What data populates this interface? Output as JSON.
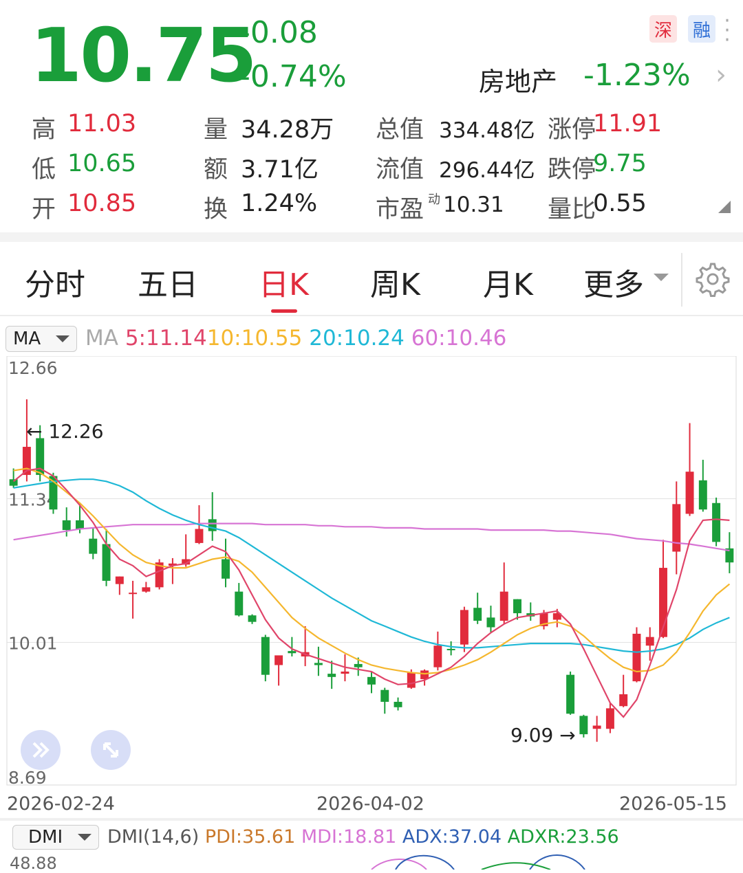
{
  "quote": {
    "price": "10.75",
    "change": "-0.08",
    "change_pct": "-0.74%",
    "sector_name": "房地产",
    "sector_change": "-1.23%",
    "exchange_tag": "深",
    "margin_tag": "融"
  },
  "stats": [
    [
      {
        "label": "高",
        "value": "11.03",
        "tone": "red"
      },
      {
        "label": "量",
        "value": "34.28万",
        "tone": "dark"
      },
      {
        "label": "总值",
        "value": "334.48亿",
        "tone": "dark"
      },
      {
        "label": "涨停",
        "value": "11.91",
        "tone": "red"
      }
    ],
    [
      {
        "label": "低",
        "value": "10.65",
        "tone": "green"
      },
      {
        "label": "额",
        "value": "3.71亿",
        "tone": "dark"
      },
      {
        "label": "流值",
        "value": "296.44亿",
        "tone": "dark"
      },
      {
        "label": "跌停",
        "value": "9.75",
        "tone": "green"
      }
    ],
    [
      {
        "label": "开",
        "value": "10.85",
        "tone": "red"
      },
      {
        "label": "换",
        "value": "1.24%",
        "tone": "dark"
      },
      {
        "label": "市盈",
        "sup": "动",
        "value": "10.31",
        "tone": "dark"
      },
      {
        "label": "量比",
        "value": "0.55",
        "tone": "dark"
      }
    ]
  ],
  "tabs": [
    {
      "label": "分时"
    },
    {
      "label": "五日"
    },
    {
      "label": "日K",
      "active": true
    },
    {
      "label": "周K"
    },
    {
      "label": "月K"
    },
    {
      "label": "更多"
    }
  ],
  "ma_bar": {
    "selector": "MA",
    "prefix": "MA",
    "ma5": "5:11.14",
    "ma10": "10:10.55",
    "ma20": "20:10.24",
    "ma60": "60:10.46"
  },
  "dmi_bar": {
    "selector": "DMI",
    "name": "DMI(14,6)",
    "pdi": "PDI:35.61",
    "mdi": "MDI:18.81",
    "adx": "ADX:37.04",
    "adxr": "ADXR:23.56",
    "ymax": "48.88"
  },
  "colors": {
    "up": "#e12b3c",
    "down": "#1a9e3a",
    "ma5": "#e0456a",
    "ma10": "#f5b72e",
    "ma20": "#1fb8d6",
    "ma60": "#d774d4",
    "pdi": "#c9782a",
    "mdi": "#d774d4",
    "adx": "#2f5fb3",
    "adxr": "#1a9e3a"
  },
  "chart_data": {
    "type": "candlestick",
    "y_ticks": [
      "12.66",
      "11.34",
      "10.01",
      "8.69"
    ],
    "ylim": [
      8.69,
      12.66
    ],
    "x_labels": [
      "2026-02-24",
      "2026-04-02",
      "2026-05-15"
    ],
    "annotations": [
      {
        "text": "← 12.26",
        "price": 12.26
      },
      {
        "text": "9.09 →",
        "price": 9.09
      }
    ],
    "candles": [
      {
        "o": 11.52,
        "h": 11.62,
        "l": 11.44,
        "c": 11.46
      },
      {
        "o": 11.56,
        "h": 12.26,
        "l": 11.5,
        "c": 11.82
      },
      {
        "o": 11.9,
        "h": 12.02,
        "l": 11.5,
        "c": 11.56
      },
      {
        "o": 11.55,
        "h": 11.58,
        "l": 11.2,
        "c": 11.24
      },
      {
        "o": 11.14,
        "h": 11.26,
        "l": 10.99,
        "c": 11.05
      },
      {
        "o": 11.14,
        "h": 11.29,
        "l": 11.02,
        "c": 11.06
      },
      {
        "o": 10.97,
        "h": 11.07,
        "l": 10.78,
        "c": 10.83
      },
      {
        "o": 10.92,
        "h": 11.06,
        "l": 10.53,
        "c": 10.58
      },
      {
        "o": 10.55,
        "h": 10.62,
        "l": 10.45,
        "c": 10.62
      },
      {
        "o": 10.47,
        "h": 10.58,
        "l": 10.23,
        "c": 10.47
      },
      {
        "o": 10.48,
        "h": 10.57,
        "l": 10.47,
        "c": 10.52
      },
      {
        "o": 10.52,
        "h": 10.78,
        "l": 10.5,
        "c": 10.75
      },
      {
        "o": 10.72,
        "h": 10.79,
        "l": 10.55,
        "c": 10.74
      },
      {
        "o": 10.73,
        "h": 11.01,
        "l": 10.71,
        "c": 10.78
      },
      {
        "o": 10.93,
        "h": 11.28,
        "l": 10.92,
        "c": 11.06
      },
      {
        "o": 11.15,
        "h": 11.4,
        "l": 10.95,
        "c": 11.04
      },
      {
        "o": 10.78,
        "h": 10.97,
        "l": 10.52,
        "c": 10.6
      },
      {
        "o": 10.48,
        "h": 10.56,
        "l": 10.25,
        "c": 10.26
      },
      {
        "o": 10.26,
        "h": 10.27,
        "l": 10.18,
        "c": 10.2
      },
      {
        "o": 10.06,
        "h": 10.08,
        "l": 9.65,
        "c": 9.71
      },
      {
        "o": 9.8,
        "h": 9.86,
        "l": 9.61,
        "c": 9.89
      },
      {
        "o": 9.93,
        "h": 10.06,
        "l": 9.88,
        "c": 9.91
      },
      {
        "o": 9.88,
        "h": 10.16,
        "l": 9.79,
        "c": 9.92
      },
      {
        "o": 9.82,
        "h": 9.97,
        "l": 9.7,
        "c": 9.8
      },
      {
        "o": 9.72,
        "h": 9.84,
        "l": 9.58,
        "c": 9.69
      },
      {
        "o": 9.72,
        "h": 9.9,
        "l": 9.65,
        "c": 9.74
      },
      {
        "o": 9.81,
        "h": 9.87,
        "l": 9.7,
        "c": 9.78
      },
      {
        "o": 9.69,
        "h": 9.74,
        "l": 9.54,
        "c": 9.62
      },
      {
        "o": 9.57,
        "h": 9.59,
        "l": 9.35,
        "c": 9.46
      },
      {
        "o": 9.46,
        "h": 9.5,
        "l": 9.38,
        "c": 9.41
      },
      {
        "o": 9.59,
        "h": 9.76,
        "l": 9.58,
        "c": 9.73
      },
      {
        "o": 9.67,
        "h": 9.76,
        "l": 9.61,
        "c": 9.75
      },
      {
        "o": 9.78,
        "h": 10.11,
        "l": 9.75,
        "c": 9.98
      },
      {
        "o": 9.95,
        "h": 10.02,
        "l": 9.89,
        "c": 9.94
      },
      {
        "o": 9.99,
        "h": 10.34,
        "l": 9.92,
        "c": 10.31
      },
      {
        "o": 10.33,
        "h": 10.47,
        "l": 10.18,
        "c": 10.21
      },
      {
        "o": 10.24,
        "h": 10.35,
        "l": 10.1,
        "c": 10.15
      },
      {
        "o": 10.21,
        "h": 10.75,
        "l": 10.18,
        "c": 10.48
      },
      {
        "o": 10.41,
        "h": 10.41,
        "l": 10.22,
        "c": 10.28
      },
      {
        "o": 10.28,
        "h": 10.38,
        "l": 10.21,
        "c": 10.25
      },
      {
        "o": 10.16,
        "h": 10.31,
        "l": 10.13,
        "c": 10.28
      },
      {
        "o": 10.22,
        "h": 10.32,
        "l": 10.15,
        "c": 10.28
      },
      {
        "o": 9.71,
        "h": 9.74,
        "l": 9.34,
        "c": 9.35
      },
      {
        "o": 9.33,
        "h": 9.34,
        "l": 9.13,
        "c": 9.16
      },
      {
        "o": 9.21,
        "h": 9.33,
        "l": 9.09,
        "c": 9.24
      },
      {
        "o": 9.21,
        "h": 9.45,
        "l": 9.17,
        "c": 9.4
      },
      {
        "o": 9.42,
        "h": 9.71,
        "l": 9.41,
        "c": 9.53
      },
      {
        "o": 9.65,
        "h": 10.15,
        "l": 9.64,
        "c": 10.09
      },
      {
        "o": 9.98,
        "h": 10.15,
        "l": 9.84,
        "c": 10.06
      },
      {
        "o": 10.06,
        "h": 10.96,
        "l": 10.05,
        "c": 10.7
      },
      {
        "o": 10.85,
        "h": 11.5,
        "l": 10.64,
        "c": 11.29
      },
      {
        "o": 11.2,
        "h": 12.04,
        "l": 11.18,
        "c": 11.59
      },
      {
        "o": 11.51,
        "h": 11.7,
        "l": 11.22,
        "c": 11.24
      },
      {
        "o": 11.3,
        "h": 11.35,
        "l": 10.9,
        "c": 10.94
      },
      {
        "o": 10.88,
        "h": 11.03,
        "l": 10.65,
        "c": 10.75
      }
    ],
    "ma5": [
      11.5,
      11.6,
      11.62,
      11.55,
      11.42,
      11.28,
      11.12,
      10.92,
      10.78,
      10.72,
      10.62,
      10.67,
      10.72,
      10.74,
      10.82,
      10.9,
      10.85,
      10.68,
      10.45,
      10.22,
      10.05,
      9.95,
      9.9,
      9.86,
      9.82,
      9.78,
      9.76,
      9.74,
      9.67,
      9.62,
      9.63,
      9.66,
      9.72,
      9.78,
      9.88,
      10.0,
      10.1,
      10.18,
      10.24,
      10.26,
      10.28,
      10.3,
      10.18,
      9.95,
      9.7,
      9.45,
      9.32,
      9.48,
      9.8,
      10.15,
      10.5,
      10.95,
      11.14,
      11.15,
      11.14
    ],
    "ma10": [
      11.6,
      11.62,
      11.58,
      11.5,
      11.4,
      11.3,
      11.18,
      11.05,
      10.92,
      10.82,
      10.75,
      10.72,
      10.7,
      10.7,
      10.74,
      10.78,
      10.8,
      10.76,
      10.66,
      10.52,
      10.38,
      10.24,
      10.14,
      10.05,
      9.98,
      9.91,
      9.85,
      9.8,
      9.77,
      9.75,
      9.73,
      9.72,
      9.73,
      9.76,
      9.8,
      9.85,
      9.92,
      10.0,
      10.08,
      10.14,
      10.18,
      10.2,
      10.16,
      10.07,
      9.96,
      9.86,
      9.78,
      9.74,
      9.75,
      9.8,
      9.92,
      10.1,
      10.3,
      10.45,
      10.55
    ],
    "ma20": [
      11.44,
      11.46,
      11.48,
      11.5,
      11.51,
      11.52,
      11.52,
      11.5,
      11.46,
      11.4,
      11.32,
      11.25,
      11.19,
      11.14,
      11.1,
      11.07,
      11.04,
      10.98,
      10.9,
      10.82,
      10.74,
      10.66,
      10.58,
      10.5,
      10.42,
      10.35,
      10.28,
      10.21,
      10.16,
      10.11,
      10.06,
      10.02,
      9.99,
      9.97,
      9.96,
      9.96,
      9.97,
      9.98,
      9.99,
      10.0,
      10.0,
      10.0,
      10.0,
      9.99,
      9.97,
      9.95,
      9.93,
      9.92,
      9.93,
      9.95,
      9.99,
      10.05,
      10.13,
      10.19,
      10.24
    ],
    "ma60": [
      10.96,
      10.98,
      11.0,
      11.02,
      11.04,
      11.06,
      11.07,
      11.08,
      11.09,
      11.1,
      11.1,
      11.1,
      11.1,
      11.1,
      11.11,
      11.11,
      11.11,
      11.11,
      11.11,
      11.1,
      11.1,
      11.1,
      11.1,
      11.09,
      11.09,
      11.08,
      11.08,
      11.08,
      11.07,
      11.07,
      11.07,
      11.06,
      11.06,
      11.06,
      11.06,
      11.06,
      11.05,
      11.05,
      11.05,
      11.05,
      11.05,
      11.04,
      11.04,
      11.03,
      11.02,
      11.01,
      10.99,
      10.97,
      10.96,
      10.95,
      10.93,
      10.92,
      10.9,
      10.88,
      10.86
    ]
  }
}
